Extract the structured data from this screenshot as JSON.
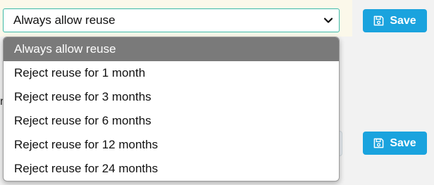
{
  "reuse_select": {
    "selected_label": "Always allow reuse",
    "options": [
      "Always allow reuse",
      "Reject reuse for 1 month",
      "Reject reuse for 3 months",
      "Reject reuse for 6 months",
      "Reject reuse for 12 months",
      "Reject reuse for 24 months"
    ],
    "highlighted_index": 0
  },
  "buttons": {
    "save_top_label": "Save",
    "save_bottom_label": "Save"
  },
  "left_sliver_text": "r",
  "colors": {
    "accent": "#1aa3de",
    "select_border": "#3cb9a7",
    "selected_option_bg": "#7a7a7a",
    "page_bg": "#f2f2f2"
  },
  "icons": {
    "save": "floppy-disk-icon",
    "select": "chevron-down-icon"
  }
}
